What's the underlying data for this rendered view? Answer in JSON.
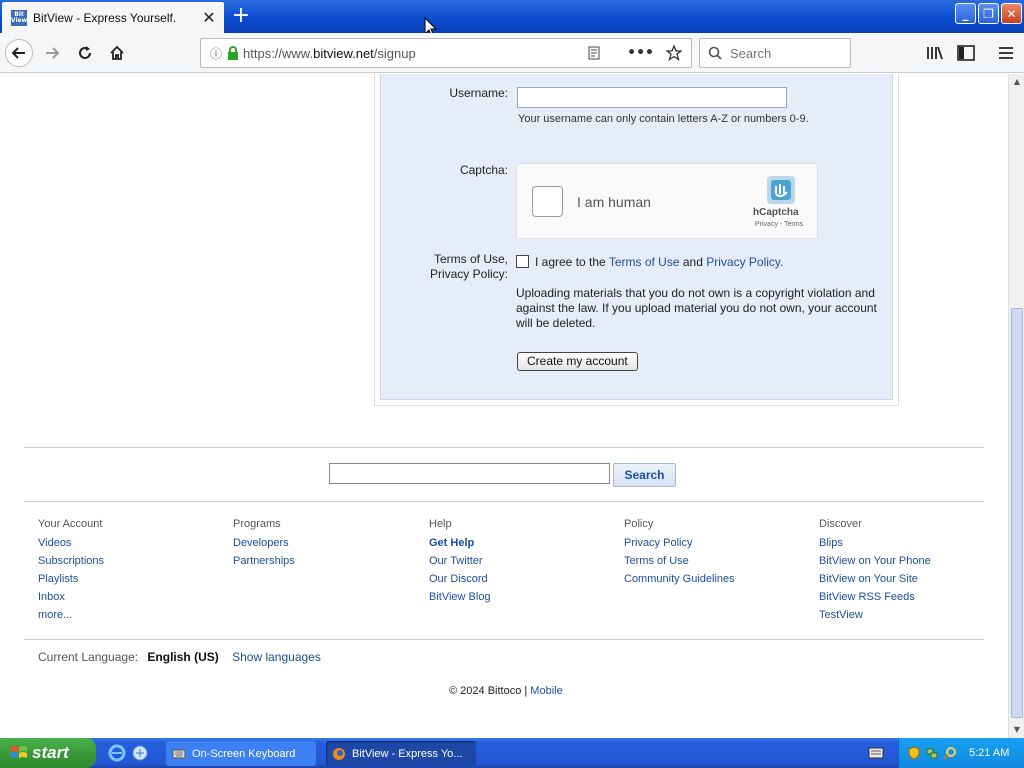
{
  "browser": {
    "tab_title": "BitView - Express Yourself.",
    "favicon_text": "Bit View",
    "url_prefix": "https://www.",
    "url_host": "bitview.net",
    "url_path": "/signup",
    "search_placeholder": "Search"
  },
  "form": {
    "username_label": "Username:",
    "username_value": "",
    "username_hint": "Your username can only contain letters A-Z or numbers 0-9.",
    "captcha_label": "Captcha:",
    "captcha_text": "I am human",
    "captcha_brand": "hCaptcha",
    "captcha_links": "Privacy - Terms",
    "terms_label_line1": "Terms of Use,",
    "terms_label_line2": "Privacy Policy:",
    "agree_prefix": "I agree to the",
    "agree_terms_link": "Terms of Use",
    "agree_and": "and",
    "agree_privacy_link": "Privacy Policy.",
    "warning": "Uploading materials that you do not own is a copyright violation and against the law. If you upload material you do not own, your account will be deleted.",
    "create_button": "Create my account"
  },
  "footer": {
    "search_button": "Search",
    "search_value": "",
    "columns": [
      {
        "head": "Your Account",
        "items": [
          "Videos",
          "Subscriptions",
          "Playlists",
          "Inbox",
          "more..."
        ]
      },
      {
        "head": "Programs",
        "items": [
          "Developers",
          "Partnerships"
        ]
      },
      {
        "head": "Help",
        "items": [
          "Get Help",
          "Our Twitter",
          "Our Discord",
          "BitView Blog"
        ]
      },
      {
        "head": "Policy",
        "items": [
          "Privacy Policy",
          "Terms of Use",
          "Community Guidelines"
        ]
      },
      {
        "head": "Discover",
        "items": [
          "Blips",
          "BitView on Your Phone",
          "BitView on Your Site",
          "BitView RSS Feeds",
          "TestView"
        ]
      }
    ],
    "language_label": "Current Language:",
    "language_value": "English (US)",
    "show_languages": "Show languages",
    "copyright": "© 2024 Bittoco |",
    "mobile_link": "Mobile"
  },
  "taskbar": {
    "start_label": "start",
    "task_osk": "On-Screen Keyboard",
    "task_firefox": "BitView - Express Yo...",
    "clock": "5:21 AM"
  },
  "colors": {
    "link": "#1c4fa0",
    "form_bg": "#e7ecf9",
    "taskbar_blue": "#245edb",
    "start_green": "#3a9a3a"
  }
}
